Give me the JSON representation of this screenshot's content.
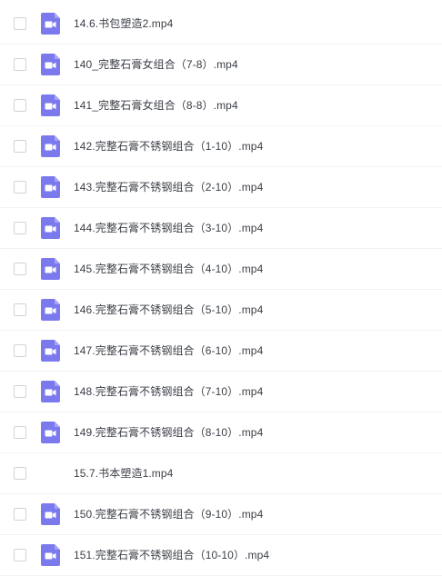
{
  "files": [
    {
      "name": "14.6.书包塑造2.mp4",
      "icon": "video-file-icon"
    },
    {
      "name": "140_完整石膏女组合（7-8）.mp4",
      "icon": "video-file-icon"
    },
    {
      "name": "141_完整石膏女组合（8-8）.mp4",
      "icon": "video-file-icon"
    },
    {
      "name": "142.完整石膏不锈钢组合（1-10）.mp4",
      "icon": "video-file-icon"
    },
    {
      "name": "143.完整石膏不锈钢组合（2-10）.mp4",
      "icon": "video-file-icon"
    },
    {
      "name": "144.完整石膏不锈钢组合（3-10）.mp4",
      "icon": "video-file-icon"
    },
    {
      "name": "145.完整石膏不锈钢组合（4-10）.mp4",
      "icon": "video-file-icon"
    },
    {
      "name": "146.完整石膏不锈钢组合（5-10）.mp4",
      "icon": "video-file-icon"
    },
    {
      "name": "147.完整石膏不锈钢组合（6-10）.mp4",
      "icon": "video-file-icon"
    },
    {
      "name": "148.完整石膏不锈钢组合（7-10）.mp4",
      "icon": "video-file-icon"
    },
    {
      "name": "149.完整石膏不锈钢组合（8-10）.mp4",
      "icon": "video-file-icon"
    },
    {
      "name": "15.7.书本塑造1.mp4",
      "icon": "video-file-icon"
    },
    {
      "name": "150.完整石膏不锈钢组合（9-10）.mp4",
      "icon": "video-file-icon"
    },
    {
      "name": "151.完整石膏不锈钢组合（10-10）.mp4",
      "icon": "video-file-icon"
    }
  ],
  "colors": {
    "icon_bg": "#7b79ee",
    "icon_fold": "#a5a3f5",
    "text": "#3b3f47",
    "divider": "#f1f2f5",
    "checkbox_border": "#cfd3da"
  }
}
